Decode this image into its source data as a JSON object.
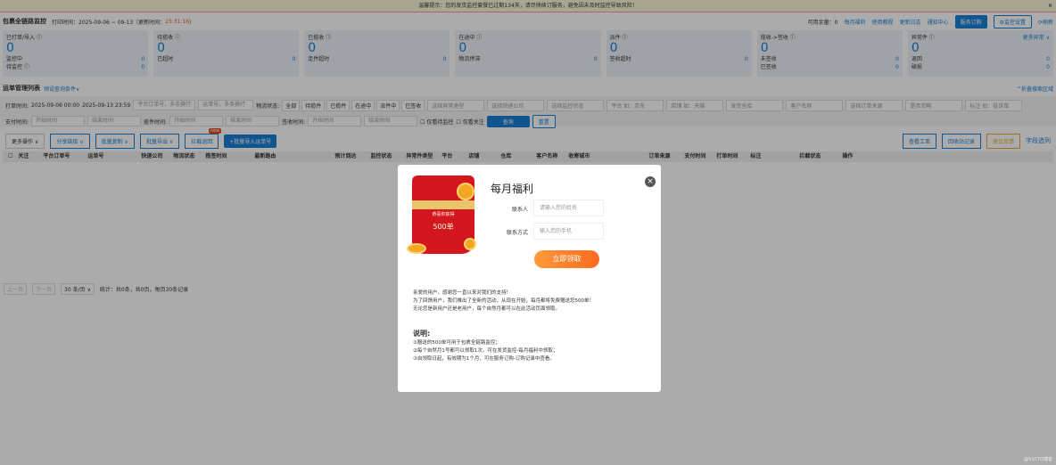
{
  "banner": {
    "text": "温馨提示：您的发货监控套餐已过期134天，请尽快续订服务，避免因未及时监控导致风险！",
    "close": "×"
  },
  "header": {
    "title": "包裹全链路监控",
    "print_time": "打印时间：2025-09-06 ~ 09-13",
    "update_label": "（更新时间：",
    "update_time": "15:31:16",
    "update_end": "）",
    "balance": "可用余量：0",
    "monthly": "每月福利",
    "tutorial": "使用教程",
    "changelog": "更新日志",
    "notify": "通知中心",
    "subscribe": "服务订购",
    "settings": "⚙监控设置",
    "refresh": "⟳刷新"
  },
  "cards": [
    {
      "label": "已打单/导入 ⓘ",
      "value": "0",
      "rows": [
        [
          "监控中",
          "0"
        ],
        [
          "待监控 ⓘ",
          "0"
        ]
      ]
    },
    {
      "label": "待揽收 ⓘ",
      "value": "0",
      "rows": [
        [
          "已超时",
          "0"
        ]
      ]
    },
    {
      "label": "已揽收 ⓘ",
      "value": "0",
      "rows": [
        [
          "走件超时",
          "0"
        ]
      ]
    },
    {
      "label": "在途中 ⓘ",
      "value": "0",
      "rows": [
        [
          "物流停滞",
          "0"
        ]
      ]
    },
    {
      "label": "派件 ⓘ",
      "value": "0",
      "rows": [
        [
          "签收超时",
          "0"
        ]
      ]
    },
    {
      "label": "揽收->签收 ⓘ",
      "value": "0",
      "rows": [
        [
          "未签收",
          "0"
        ],
        [
          "已签收",
          "0"
        ]
      ]
    },
    {
      "label": "异常件 ⓘ",
      "value": "0",
      "more": "更多异常 ∨",
      "rows": [
        [
          "退回",
          "0"
        ],
        [
          "破损",
          "0"
        ]
      ]
    }
  ],
  "list": {
    "title": "运单管理列表",
    "preset": "预设查询条件∨",
    "collapse": "^折叠搜索区域"
  },
  "filters": {
    "print_label": "打单时间:",
    "print_start": "2025-09-06 00:00",
    "print_end": "2025-09-13 23:59",
    "order_ph": "平台订单号，多条换行",
    "waybill_ph": "运单号，多条换行",
    "status_label": "物流状态:",
    "status_chips": [
      "全部",
      "待揽件",
      "已揽件",
      "在途中",
      "派件中",
      "已签收"
    ],
    "selects": [
      "选择异常类型",
      "选择快递公司",
      "选择监控状态",
      "平台 如：京东",
      "店铺 如：天猫",
      "发货仓库",
      "客户名称",
      "选择订单来源",
      "是否忽略",
      "标注 如：投诉单"
    ],
    "pay_label": "支付时间:",
    "pickup_label": "揽件时间:",
    "sign_label": "签收时间:",
    "start_ph": "开始时间",
    "end_ph": "结束时间",
    "only_pending": "仅看待监控",
    "only_follow": "仅看关注",
    "query": "查询",
    "reset": "重置"
  },
  "toolbar": {
    "more": "更多操作 ∨",
    "share": "分享链接 ∨",
    "batch_copy": "批量复制 ∨",
    "batch_export": "批量导出 ∨",
    "intercept": "拦截退回",
    "new_badge": "new",
    "import": "+批量导入运单号",
    "tickets": "查看工单",
    "callback": "回收站记录",
    "feedback": "建议反馈",
    "columns": "字段选列"
  },
  "columns": [
    "关注",
    "平台订单号",
    "运单号",
    "快递公司",
    "物流状态",
    "揽签时间",
    "最新路由",
    "预计到达",
    "监控状态",
    "异常件类型",
    "平台",
    "店铺",
    "仓库",
    "客户名称",
    "收寄城市",
    "订单来源",
    "支付时间",
    "打单时间",
    "标注",
    "拦截状态",
    "操作"
  ],
  "pagination": {
    "prev": "上一页",
    "next": "下一页",
    "size": "30 条/页 ∨",
    "stats": "统计：共0条，共0页，每页30条记录"
  },
  "modal": {
    "title": "每月福利",
    "envelope_line1": "恭喜你获得",
    "envelope_line2": "500单",
    "contact_label": "联系人",
    "contact_ph": "请输入您的姓名",
    "phone_label": "联系方式",
    "phone_ph": "输入您的手机",
    "cta": "立即领取",
    "close": "×",
    "desc": [
      "亲爱的用户，感谢您一直以来对我们的支持！",
      "为了回馈用户，我们推出了全新的活动，从现在开始，每月都将免费赠送您500单！",
      "无论您是新用户还是老用户，每个自然月都可以在此活动页面领取。"
    ],
    "note_title": "说明:",
    "notes": [
      "①赠送的500单可用于包裹全链路监控；",
      "②每个自然月1号都可以领取1次，可在发货监控-每月福利中领取；",
      "③自领取日起，有效期为1个月，可在服务订购-订购记录中查看。"
    ]
  },
  "watermark": "@51CTO博客"
}
